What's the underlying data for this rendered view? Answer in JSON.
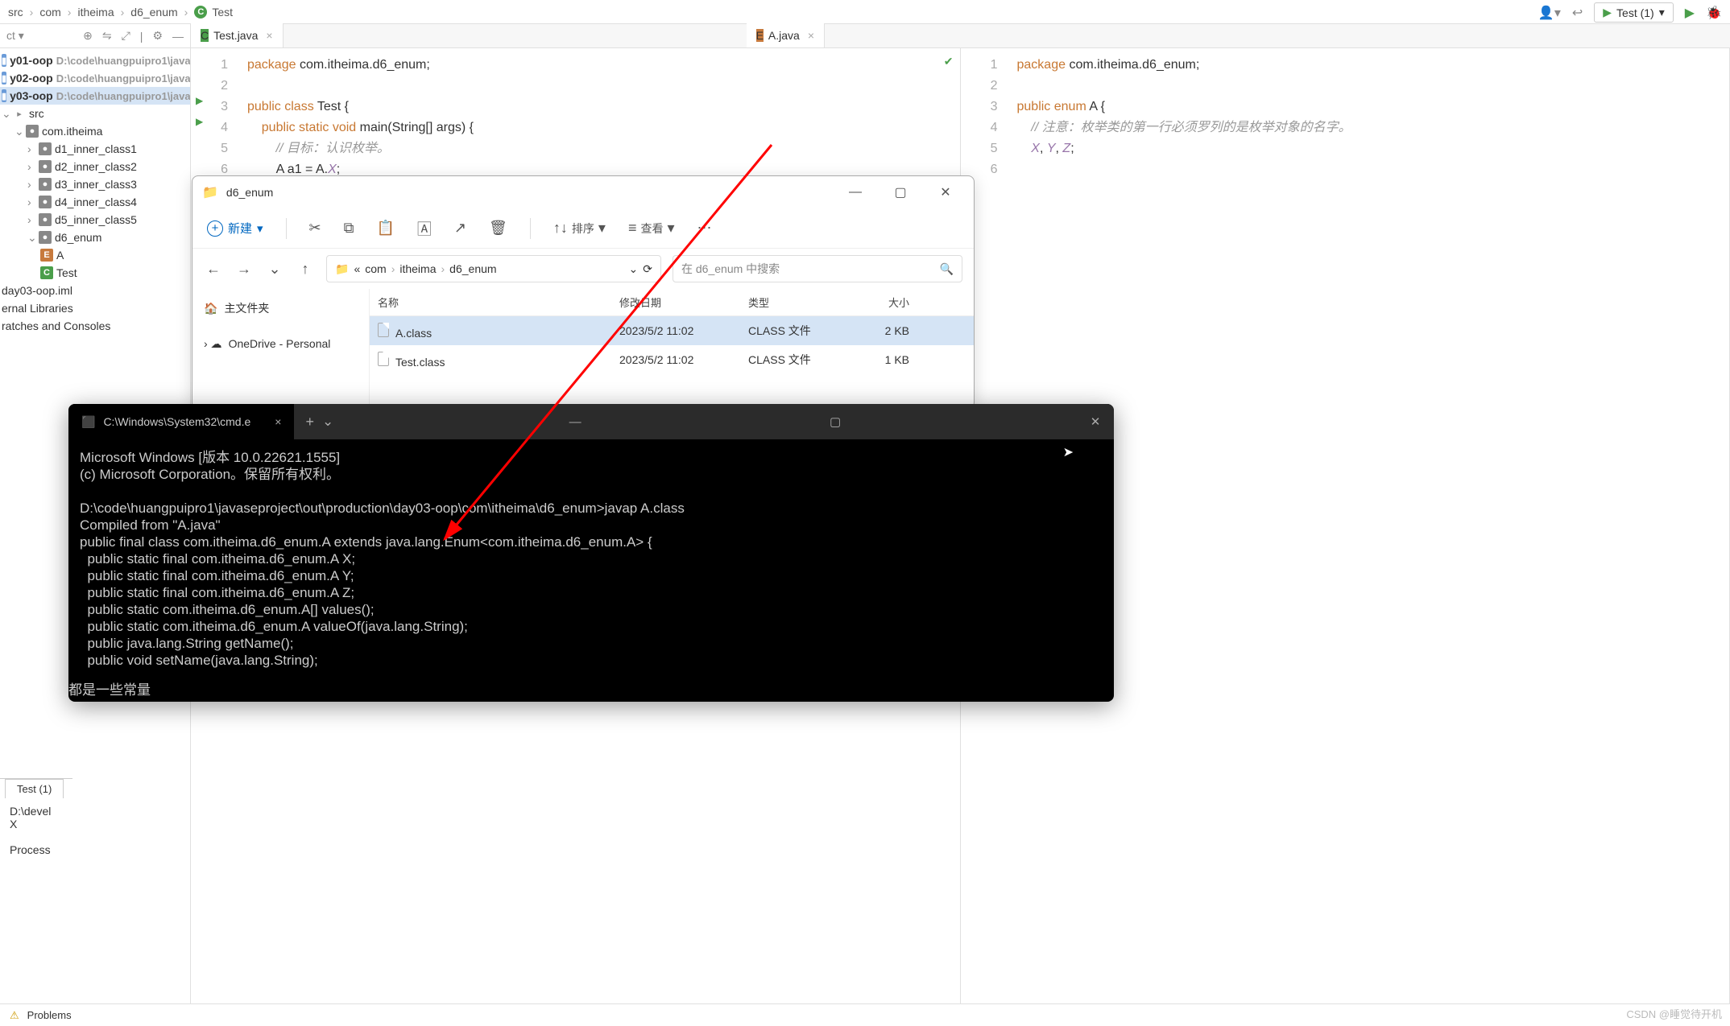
{
  "breadcrumbs": [
    "src",
    "com",
    "itheima",
    "d6_enum",
    "Test"
  ],
  "runConfig": "Test (1)",
  "sidebarRows": [
    {
      "ind": 0,
      "icon": "mod",
      "bold": true,
      "label": "y01-oop",
      "path": "D:\\code\\huangpuipro1\\java"
    },
    {
      "ind": 0,
      "icon": "mod",
      "bold": true,
      "label": "y02-oop",
      "path": "D:\\code\\huangpuipro1\\java"
    },
    {
      "ind": 0,
      "icon": "mod",
      "bold": true,
      "label": "y03-oop",
      "path": "D:\\code\\huangpuipro1\\java",
      "sel": true
    },
    {
      "ind": 0,
      "arr": "v",
      "icon": "dir",
      "label": "src"
    },
    {
      "ind": 1,
      "arr": "v",
      "icon": "pkg",
      "label": "com.itheima"
    },
    {
      "ind": 2,
      "arr": ">",
      "icon": "pkg",
      "label": "d1_inner_class1"
    },
    {
      "ind": 2,
      "arr": ">",
      "icon": "pkg",
      "label": "d2_inner_class2"
    },
    {
      "ind": 2,
      "arr": ">",
      "icon": "pkg",
      "label": "d3_inner_class3"
    },
    {
      "ind": 2,
      "arr": ">",
      "icon": "pkg",
      "label": "d4_inner_class4"
    },
    {
      "ind": 2,
      "arr": ">",
      "icon": "pkg",
      "label": "d5_inner_class5"
    },
    {
      "ind": 2,
      "arr": "v",
      "icon": "pkg",
      "label": "d6_enum"
    },
    {
      "ind": 3,
      "icon": "e",
      "label": "A"
    },
    {
      "ind": 3,
      "icon": "c",
      "label": "Test"
    },
    {
      "ind": 0,
      "icon": "",
      "label": "day03-oop.iml"
    },
    {
      "ind": 0,
      "icon": "",
      "label": "ernal Libraries"
    },
    {
      "ind": 0,
      "icon": "",
      "label": "ratches and Consoles"
    }
  ],
  "tabs": {
    "left": "Test.java",
    "right": "A.java"
  },
  "leftCode": {
    "lines": [
      "1",
      "2",
      "3",
      "4",
      "5",
      "6"
    ],
    "l1_kw": "package",
    "l1_rest": " com.itheima.d6_enum;",
    "l3_kw": "public class",
    "l3_cls": " Test {",
    "l4_kw": "public static void",
    "l4_m": " main",
    "l4_rest": "(String[] args) {",
    "l5_cm": "// 目标：认识枚举。",
    "l6": "A a1 = A.",
    "l6_fld": "X",
    "l6_end": ";"
  },
  "rightCode": {
    "lines": [
      "1",
      "2",
      "3",
      "4",
      "5",
      "6"
    ],
    "l1_kw": "package",
    "l1_rest": " com.itheima.d6_enum;",
    "l3_kw": "public enum",
    "l3_cls": " A {",
    "l4_cm": "// 注意：枚举类的第一行必须罗列的是枚举对象的名字。",
    "l5_x": "X",
    "l5_c1": ", ",
    "l5_y": "Y",
    "l5_c2": ", ",
    "l5_z": "Z",
    "l5_end": ";"
  },
  "runPanel": {
    "tab": "Test (1)",
    "line1": "D:\\devel",
    "line2": "X",
    "line3": "Process"
  },
  "statusBar": {
    "problems": "Problems"
  },
  "explorer": {
    "title": "d6_enum",
    "newBtn": "新建",
    "sort": "排序",
    "view": "查看",
    "path": [
      "com",
      "itheima",
      "d6_enum"
    ],
    "searchPlaceholder": "在 d6_enum 中搜索",
    "sideMain": "主文件夹",
    "sideOD": "OneDrive - Personal",
    "cols": {
      "name": "名称",
      "date": "修改日期",
      "type": "类型",
      "size": "大小"
    },
    "rows": [
      {
        "name": "A.class",
        "date": "2023/5/2 11:02",
        "type": "CLASS 文件",
        "size": "2 KB",
        "sel": true
      },
      {
        "name": "Test.class",
        "date": "2023/5/2 11:02",
        "type": "CLASS 文件",
        "size": "1 KB"
      }
    ]
  },
  "terminal": {
    "tabTitle": "C:\\Windows\\System32\\cmd.e",
    "lines": [
      "Microsoft Windows [版本 10.0.22621.1555]",
      "(c) Microsoft Corporation。保留所有权利。",
      "",
      "D:\\code\\huangpuipro1\\javaseproject\\out\\production\\day03-oop\\com\\itheima\\d6_enum>javap A.class",
      "Compiled from \"A.java\"",
      "public final class com.itheima.d6_enum.A extends java.lang.Enum<com.itheima.d6_enum.A> {",
      "  public static final com.itheima.d6_enum.A X;",
      "  public static final com.itheima.d6_enum.A Y;",
      "  public static final com.itheima.d6_enum.A Z;",
      "  public static com.itheima.d6_enum.A[] values();",
      "  public static com.itheima.d6_enum.A valueOf(java.lang.String);",
      "  public java.lang.String getName();",
      "  public void setName(java.lang.String);"
    ],
    "annotation": "都是一些常量"
  },
  "watermark": "CSDN @睡觉待开机"
}
